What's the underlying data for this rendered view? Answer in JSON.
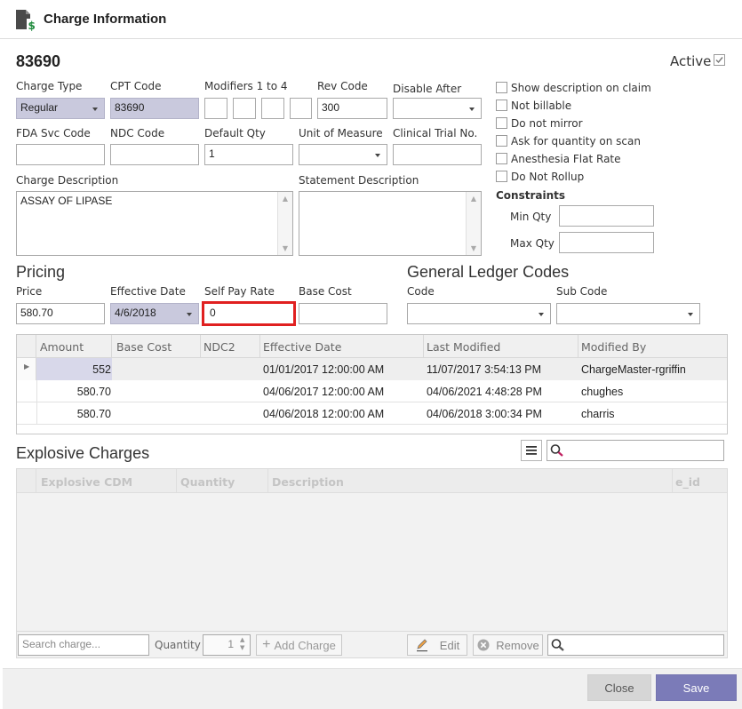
{
  "window": {
    "title": "Charge Information"
  },
  "charge": {
    "code": "83690",
    "active_label": "Active",
    "active": true
  },
  "fields": {
    "charge_type": {
      "label": "Charge Type",
      "value": "Regular"
    },
    "cpt_code": {
      "label": "CPT Code",
      "value": "83690"
    },
    "modifiers": {
      "label": "Modifiers 1 to 4",
      "values": [
        "",
        "",
        "",
        ""
      ]
    },
    "rev_code": {
      "label": "Rev Code",
      "value": "300"
    },
    "disable_after": {
      "label": "Disable After",
      "value": ""
    },
    "fda_svc_code": {
      "label": "FDA Svc Code",
      "value": ""
    },
    "ndc_code": {
      "label": "NDC Code",
      "value": ""
    },
    "default_qty": {
      "label": "Default Qty",
      "value": "1"
    },
    "unit_of_measure": {
      "label": "Unit of Measure",
      "value": ""
    },
    "clinical_trial_no": {
      "label": "Clinical Trial No.",
      "value": ""
    },
    "charge_description": {
      "label": "Charge Description",
      "value": "ASSAY OF LIPASE"
    },
    "statement_description": {
      "label": "Statement Description",
      "value": ""
    }
  },
  "options": {
    "show_description_on_claim": "Show description on claim",
    "not_billable": "Not billable",
    "do_not_mirror": "Do not mirror",
    "ask_for_quantity_on_scan": "Ask for quantity on scan",
    "anesthesia_flat_rate": "Anesthesia Flat Rate",
    "do_not_rollup": "Do Not Rollup"
  },
  "constraints": {
    "title": "Constraints",
    "min_qty_label": "Min Qty",
    "min_qty": "",
    "max_qty_label": "Max Qty",
    "max_qty": ""
  },
  "pricing": {
    "title": "Pricing",
    "price_label": "Price",
    "price": "580.70",
    "effective_date_label": "Effective Date",
    "effective_date": "4/6/2018",
    "self_pay_rate_label": "Self Pay Rate",
    "self_pay_rate": "0",
    "base_cost_label": "Base Cost",
    "base_cost": ""
  },
  "gl": {
    "title": "General Ledger Codes",
    "code_label": "Code",
    "code": "",
    "sub_code_label": "Sub Code",
    "sub_code": ""
  },
  "price_grid": {
    "columns": [
      "Amount",
      "Base Cost",
      "NDC2",
      "Effective Date",
      "Last Modified",
      "Modified By"
    ],
    "rows": [
      {
        "amount": "552",
        "base_cost": "",
        "ndc2": "",
        "effective_date": "01/01/2017 12:00:00 AM",
        "last_modified": "11/07/2017 3:54:13 PM",
        "modified_by": "ChargeMaster-rgriffin"
      },
      {
        "amount": "580.70",
        "base_cost": "",
        "ndc2": "",
        "effective_date": "04/06/2017 12:00:00 AM",
        "last_modified": "04/06/2021 4:48:28 PM",
        "modified_by": "chughes"
      },
      {
        "amount": "580.70",
        "base_cost": "",
        "ndc2": "",
        "effective_date": "04/06/2018 12:00:00 AM",
        "last_modified": "04/06/2018 3:00:34 PM",
        "modified_by": "charris"
      }
    ]
  },
  "explosive": {
    "title": "Explosive Charges",
    "columns": [
      "Explosive CDM",
      "Quantity",
      "Description",
      "e_id"
    ],
    "search_charge_placeholder": "Search charge...",
    "quantity_label": "Quantity",
    "quantity": "1",
    "add_charge_label": "Add Charge",
    "edit_label": "Edit",
    "remove_label": "Remove"
  },
  "footer": {
    "close_label": "Close",
    "save_label": "Save"
  },
  "colors": {
    "accent": "#7b7bb8",
    "highlight": "#e02020",
    "disabled_field": "#c9c9dd"
  }
}
